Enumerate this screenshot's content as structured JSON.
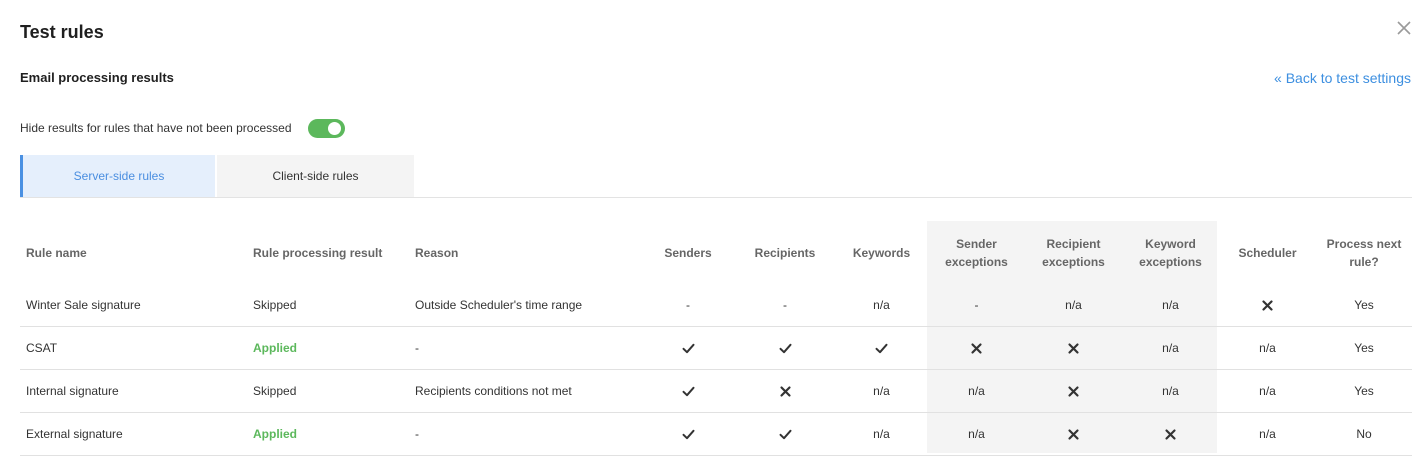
{
  "dialog": {
    "title": "Test rules",
    "subtitle": "Email processing results",
    "back_link": "« Back to test settings",
    "toggle_label": "Hide results for rules that have not been processed",
    "toggle_on": true,
    "accent_color": "#5cb85c",
    "link_color": "#3d8fe0"
  },
  "tabs": [
    {
      "label": "Server-side rules",
      "active": true
    },
    {
      "label": "Client-side rules",
      "active": false
    }
  ],
  "table": {
    "headers": [
      "Rule name",
      "Rule processing result",
      "Reason",
      "Senders",
      "Recipients",
      "Keywords",
      "Sender exceptions",
      "Recipient exceptions",
      "Keyword exceptions",
      "Scheduler",
      "Process next rule?"
    ],
    "rows": [
      {
        "name": "Winter Sale signature",
        "result": "Skipped",
        "reason": "Outside Scheduler's time range",
        "senders": "-",
        "recipients": "-",
        "keywords": "n/a",
        "sender_exceptions": "-",
        "recipient_exceptions": "n/a",
        "keyword_exceptions": "n/a",
        "scheduler": "cross-icon",
        "process_next": "Yes"
      },
      {
        "name": "CSAT",
        "result": "Applied",
        "reason": "-",
        "senders": "check-icon",
        "recipients": "check-icon",
        "keywords": "check-icon",
        "sender_exceptions": "cross-icon",
        "recipient_exceptions": "cross-icon",
        "keyword_exceptions": "n/a",
        "scheduler": "n/a",
        "process_next": "Yes"
      },
      {
        "name": "Internal signature",
        "result": "Skipped",
        "reason": "Recipients conditions not met",
        "senders": "check-icon",
        "recipients": "cross-icon",
        "keywords": "n/a",
        "sender_exceptions": "n/a",
        "recipient_exceptions": "cross-icon",
        "keyword_exceptions": "n/a",
        "scheduler": "n/a",
        "process_next": "Yes"
      },
      {
        "name": "External signature",
        "result": "Applied",
        "reason": "-",
        "senders": "check-icon",
        "recipients": "check-icon",
        "keywords": "n/a",
        "sender_exceptions": "n/a",
        "recipient_exceptions": "cross-icon",
        "keyword_exceptions": "cross-icon",
        "scheduler": "n/a",
        "process_next": "No"
      }
    ]
  }
}
